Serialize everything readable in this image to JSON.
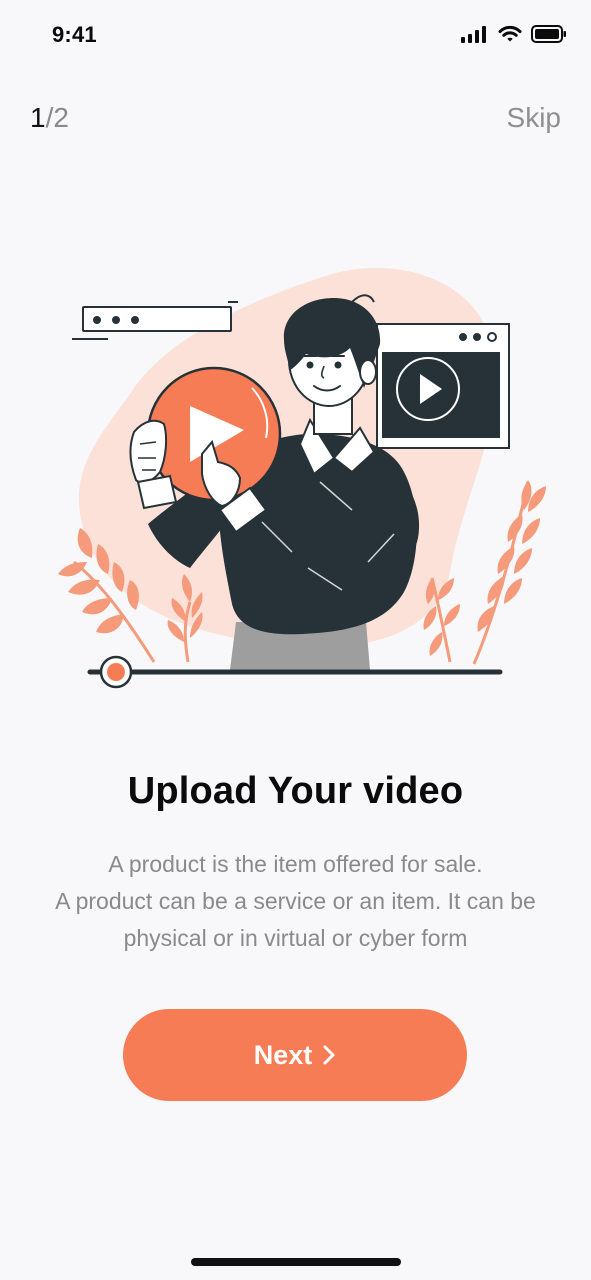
{
  "status_bar": {
    "time": "9:41",
    "icons": [
      "cellular-signal-icon",
      "wifi-icon",
      "battery-icon"
    ]
  },
  "onboarding": {
    "pager": {
      "current": "1",
      "separator": "/",
      "total": "2"
    },
    "skip_label": "Skip",
    "illustration": {
      "name": "upload-video-illustration",
      "colors": {
        "blob": "#FBE1D7",
        "accent": "#F67C55",
        "dark": "#263238",
        "outline": "#263238"
      }
    },
    "title": "Upload Your video",
    "description_lines": [
      "A product is the item offered for sale.",
      "A product can be a service or an item. It can be",
      "physical or in virtual or cyber form"
    ],
    "next_button": {
      "label": "Next",
      "icon": "chevron-right-icon",
      "color": "#F67C55"
    }
  }
}
